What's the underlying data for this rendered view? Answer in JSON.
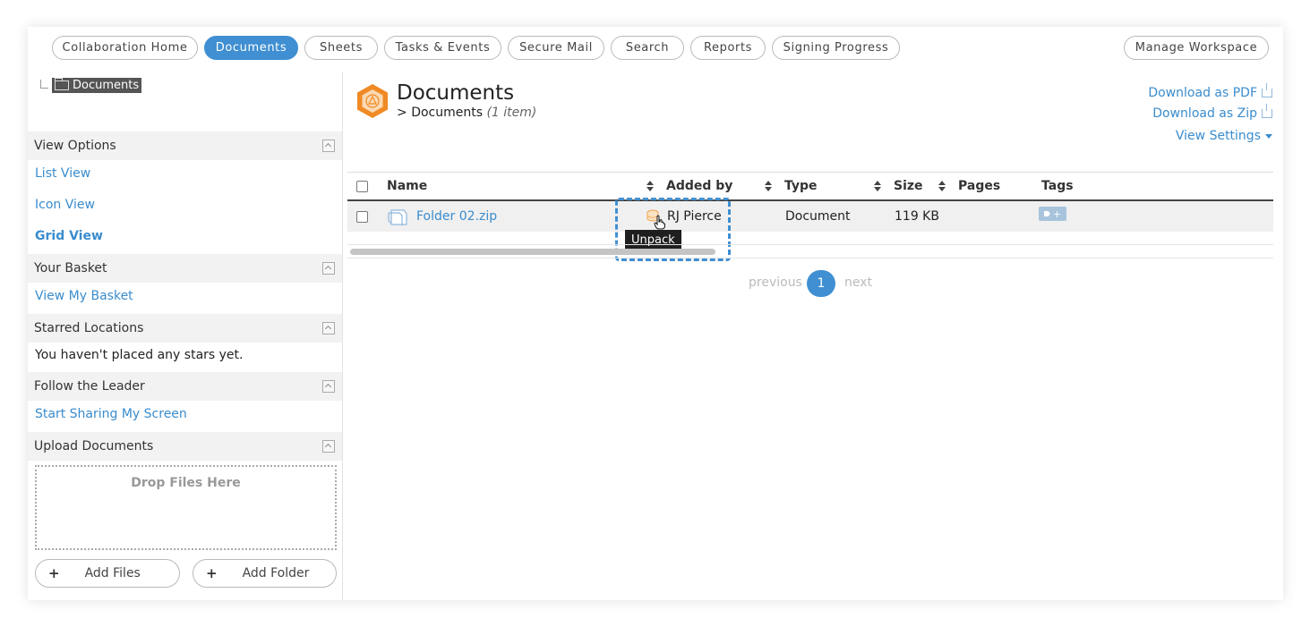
{
  "nav": {
    "tabs": [
      {
        "label": "Collaboration Home"
      },
      {
        "label": "Documents"
      },
      {
        "label": "Sheets"
      },
      {
        "label": "Tasks & Events"
      },
      {
        "label": "Secure Mail"
      },
      {
        "label": "Search"
      },
      {
        "label": "Reports"
      },
      {
        "label": "Signing Progress"
      }
    ],
    "active_tab": "Documents",
    "manage_label": "Manage Workspace"
  },
  "sidebar": {
    "tree_root": "Documents",
    "view_options": {
      "title": "View Options",
      "list": "List View",
      "icon": "Icon View",
      "grid": "Grid View"
    },
    "basket": {
      "title": "Your Basket",
      "link": "View My Basket"
    },
    "starred": {
      "title": "Starred Locations",
      "empty_text": "You haven't placed any stars yet."
    },
    "leader": {
      "title": "Follow the Leader",
      "link": "Start Sharing My Screen"
    },
    "upload": {
      "title": "Upload Documents",
      "drop_text": "Drop Files Here",
      "add_files": "Add Files",
      "add_folder": "Add Folder"
    }
  },
  "main": {
    "title": "Documents",
    "breadcrumb_prefix": ">",
    "breadcrumb": "Documents",
    "item_count": "(1 item)",
    "download_pdf": "Download as PDF",
    "download_zip": "Download as Zip",
    "view_settings": "View Settings",
    "columns": {
      "name": "Name",
      "added_by": "Added by",
      "type": "Type",
      "size": "Size",
      "pages": "Pages",
      "tags": "Tags"
    },
    "rows": [
      {
        "name": "Folder 02.zip",
        "added_by": "RJ Pierce",
        "type": "Document",
        "size": "119 KB",
        "pages": "",
        "tag_plus": "+"
      }
    ],
    "tooltip": "Unpack",
    "pagination": {
      "previous": "previous",
      "current": "1",
      "next": "next"
    }
  },
  "colors": {
    "accent": "#3f8fd2",
    "link": "#3a8ccd",
    "logo": "#f08a24"
  }
}
